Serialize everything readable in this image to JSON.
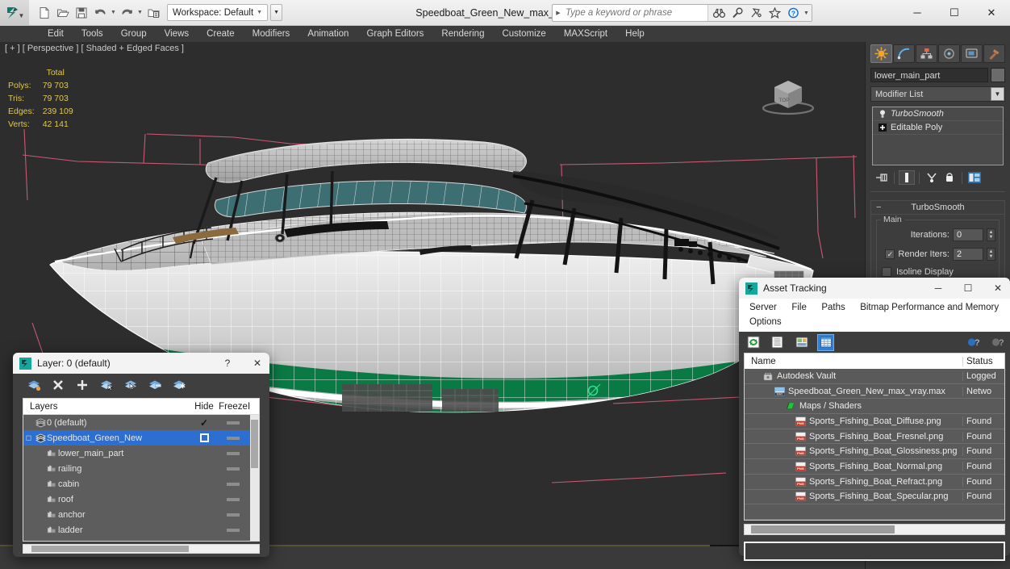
{
  "app": {
    "document_title": "Speedboat_Green_New_max_vray.max",
    "workspace_label": "Workspace: Default"
  },
  "quick_access": [
    {
      "name": "new-file-icon",
      "label": "New"
    },
    {
      "name": "open-file-icon",
      "label": "Open"
    },
    {
      "name": "save-file-icon",
      "label": "Save"
    },
    {
      "name": "undo-icon",
      "label": "Undo"
    },
    {
      "name": "redo-icon",
      "label": "Redo"
    },
    {
      "name": "project-folder-icon",
      "label": "Set Project Folder"
    }
  ],
  "search": {
    "placeholder": "Type a keyword or phrase",
    "icons": [
      "binoculars-icon",
      "magnifier-icon",
      "satellite-icon",
      "star-icon",
      "help-icon"
    ]
  },
  "window_controls": {
    "minimize": "─",
    "maximize": "☐",
    "close": "✕"
  },
  "menubar": {
    "items": [
      "Edit",
      "Tools",
      "Group",
      "Views",
      "Create",
      "Modifiers",
      "Animation",
      "Graph Editors",
      "Rendering",
      "Customize",
      "MAXScript",
      "Help"
    ]
  },
  "viewport": {
    "label": "[ + ] [ Perspective ] [ Shaded + Edged Faces ]",
    "stats": {
      "header": "Total",
      "rows": [
        {
          "label": "Polys:",
          "value": "79 703"
        },
        {
          "label": "Tris:",
          "value": "79 703"
        },
        {
          "label": "Edges:",
          "value": "239 109"
        },
        {
          "label": "Verts:",
          "value": "42 141"
        }
      ]
    },
    "viewcube_label": "TOP"
  },
  "command_panel": {
    "tabs": [
      {
        "name": "create-tab",
        "icon": "create-star-icon",
        "active": true
      },
      {
        "name": "modify-tab",
        "icon": "modify-curve-icon",
        "active": false
      },
      {
        "name": "hierarchy-tab",
        "icon": "hierarchy-icon",
        "active": false
      },
      {
        "name": "motion-tab",
        "icon": "motion-wheel-icon",
        "active": false
      },
      {
        "name": "display-tab",
        "icon": "display-monitor-icon",
        "active": false
      },
      {
        "name": "utilities-tab",
        "icon": "hammer-icon",
        "active": false
      }
    ],
    "object_name": "lower_main_part",
    "modifier_list_label": "Modifier List",
    "modifier_stack": [
      {
        "label": "TurboSmooth",
        "icon": "lightbulb-icon",
        "selected": true
      },
      {
        "label": "Editable Poly",
        "icon": "plus-box-icon",
        "selected": false
      }
    ],
    "stack_tools": [
      "pin-stack-icon",
      "show-end-result-icon",
      "make-unique-icon",
      "remove-modifier-icon",
      "configure-modifier-sets-icon"
    ],
    "rollout": {
      "title": "TurboSmooth",
      "collapse_glyph": "−",
      "group_label": "Main",
      "iterations_label": "Iterations:",
      "iterations_value": "0",
      "render_iters_label": "Render Iters:",
      "render_iters_value": "2",
      "render_iters_checked": true,
      "isoline_label": "Isoline Display",
      "isoline_checked": false
    }
  },
  "layer_window": {
    "title": "Layer: 0 (default)",
    "help_glyph": "?",
    "close_glyph": "✕",
    "toolbar": [
      "create-new-layer-icon",
      "delete-highlighted-empty-layers-icon",
      "add-selected-objects-to-highlighted-layer-icon",
      "select-highlighted-objects-and-layers-icon",
      "highlight-selected-objects-layers-icon",
      "hide-unhide-all-layers-icon",
      "freeze-unfreeze-all-layers-icon"
    ],
    "columns": [
      "Layers",
      "Hide",
      "Freeze",
      "I"
    ],
    "rows": [
      {
        "name": "0 (default)",
        "indent": 0,
        "icon": "layer-icon",
        "selected": false,
        "current": true,
        "expandable": false
      },
      {
        "name": "Speedboat_Green_New",
        "indent": 0,
        "icon": "layer-icon",
        "selected": true,
        "current": false,
        "expandable": true
      },
      {
        "name": "lower_main_part",
        "indent": 1,
        "icon": "object-icon",
        "selected": false,
        "current": false,
        "expandable": false
      },
      {
        "name": "railing",
        "indent": 1,
        "icon": "object-icon",
        "selected": false,
        "current": false,
        "expandable": false
      },
      {
        "name": "cabin",
        "indent": 1,
        "icon": "object-icon",
        "selected": false,
        "current": false,
        "expandable": false
      },
      {
        "name": "roof",
        "indent": 1,
        "icon": "object-icon",
        "selected": false,
        "current": false,
        "expandable": false
      },
      {
        "name": "anchor",
        "indent": 1,
        "icon": "object-icon",
        "selected": false,
        "current": false,
        "expandable": false
      },
      {
        "name": "ladder",
        "indent": 1,
        "icon": "object-icon",
        "selected": false,
        "current": false,
        "expandable": false
      }
    ]
  },
  "asset_window": {
    "title": "Asset Tracking",
    "app_icon": "max-app-icon",
    "minimize_glyph": "─",
    "maximize_glyph": "☐",
    "close_glyph": "✕",
    "menus": [
      "Server",
      "File",
      "Paths",
      "Bitmap Performance and Memory",
      "Options"
    ],
    "toolbar": [
      {
        "name": "refresh-icon",
        "active": false
      },
      {
        "name": "list-view-icon",
        "active": false
      },
      {
        "name": "thumbnail-view-icon",
        "active": false
      },
      {
        "name": "grid-view-icon",
        "active": true
      }
    ],
    "toolbar_right": [
      {
        "name": "help-blue-icon"
      },
      {
        "name": "help-gray-icon"
      }
    ],
    "columns": [
      "Name",
      "Status"
    ],
    "rows": [
      {
        "name": "Autodesk Vault",
        "status": "Logged",
        "indent": 0,
        "icon": "vault-icon"
      },
      {
        "name": "Speedboat_Green_New_max_vray.max",
        "status": "Netwo",
        "indent": 1,
        "icon": "max-file-icon"
      },
      {
        "name": "Maps / Shaders",
        "status": "",
        "indent": 2,
        "icon": "maps-icon"
      },
      {
        "name": "Sports_Fishing_Boat_Diffuse.png",
        "status": "Found",
        "indent": 3,
        "icon": "png-icon"
      },
      {
        "name": "Sports_Fishing_Boat_Fresnel.png",
        "status": "Found",
        "indent": 3,
        "icon": "png-icon"
      },
      {
        "name": "Sports_Fishing_Boat_Glossiness.png",
        "status": "Found",
        "indent": 3,
        "icon": "png-icon"
      },
      {
        "name": "Sports_Fishing_Boat_Normal.png",
        "status": "Found",
        "indent": 3,
        "icon": "png-icon"
      },
      {
        "name": "Sports_Fishing_Boat_Refract.png",
        "status": "Found",
        "indent": 3,
        "icon": "png-icon"
      },
      {
        "name": "Sports_Fishing_Boat_Specular.png",
        "status": "Found",
        "indent": 3,
        "icon": "png-icon"
      }
    ]
  },
  "colors": {
    "accent_blue": "#2c6fd1",
    "stats_yellow": "#e0c84c",
    "hull_green": "#0a7a44",
    "glass_teal": "#3d6e72",
    "helper_pink": "#c85a74",
    "panel_gray": "#3a3a3a",
    "viewport_bg": "#2d2d2d"
  }
}
